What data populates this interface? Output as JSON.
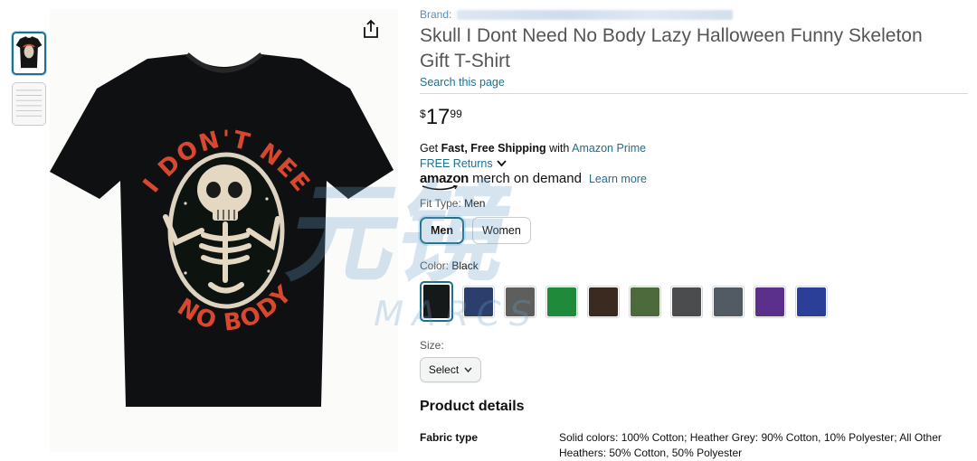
{
  "brand": {
    "label": "Brand:"
  },
  "product": {
    "title": "Skull I Dont Need No Body Lazy Halloween Funny Skeleton Gift T-Shirt",
    "search_page": "Search this page"
  },
  "price": {
    "symbol": "$",
    "whole": "17",
    "fraction": "99"
  },
  "shipping": {
    "prefix": "Get",
    "bold": "Fast, Free Shipping",
    "with": "with",
    "prime": "Amazon Prime",
    "returns": "FREE Returns"
  },
  "merch": {
    "amazon": "amazon",
    "rest": "merch on demand",
    "learn_more": "Learn more"
  },
  "fit": {
    "label": "Fit Type:",
    "selected": "Men",
    "options": [
      "Men",
      "Women"
    ]
  },
  "color": {
    "label": "Color:",
    "selected": "Black",
    "swatches": [
      "#16191a",
      "#2c3e6b",
      "#5e5f5d",
      "#1f8a3a",
      "#3b2a20",
      "#4d6a3c",
      "#4b4c4d",
      "#525b63",
      "#5b2f8c",
      "#2b3f98"
    ]
  },
  "size": {
    "label": "Size:",
    "select_label": "Select"
  },
  "product_details": {
    "heading": "Product details",
    "rows": [
      {
        "key": "Fabric type",
        "value": "Solid colors: 100% Cotton; Heather Grey: 90% Cotton, 10% Polyester; All Other Heathers: 50% Cotton, 50% Polyester"
      }
    ]
  },
  "shirt_art": {
    "top_text": "I DON'T NEED",
    "bottom_text": "NO BODY"
  },
  "watermark": {
    "text": "元镜",
    "sub": "MARCS"
  },
  "icons": {
    "share": "share-icon",
    "chevron": "chevron-down-icon"
  }
}
